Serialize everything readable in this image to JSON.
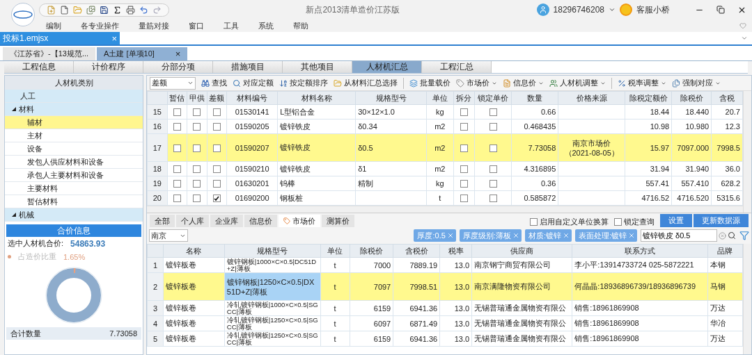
{
  "window": {
    "title": "新点2013清单造价江苏版",
    "user": "18296746208",
    "support": "客服小桥"
  },
  "menu": [
    "编制",
    "各专业操作",
    "量筋对接",
    "窗口",
    "工具",
    "系统",
    "帮助"
  ],
  "doc_tabs": [
    {
      "label": "投标1.emjsx",
      "selected": true,
      "close": "×"
    }
  ],
  "sub_tabs": [
    {
      "label": "《江苏省》-【13规范...",
      "selected": false
    },
    {
      "label": "A土建 [单项10]",
      "selected": true,
      "close": "×"
    }
  ],
  "main_tabs": [
    {
      "label": "工程信息",
      "selected": false
    },
    {
      "label": "计价程序",
      "selected": false
    },
    {
      "label": "分部分项",
      "selected": false
    },
    {
      "label": "措施项目",
      "selected": false
    },
    {
      "label": "其他项目",
      "selected": false
    },
    {
      "label": "人材机汇总",
      "selected": true
    },
    {
      "label": "工程汇总",
      "selected": false
    }
  ],
  "category": {
    "title": "人材机类别",
    "items": [
      {
        "label": "人工",
        "selected": false
      },
      {
        "label": "材料",
        "selected": false,
        "expanded": true,
        "children": [
          {
            "label": "辅材",
            "selected": true
          },
          {
            "label": "主材",
            "selected": false
          },
          {
            "label": "设备",
            "selected": false
          },
          {
            "label": "发包人供应材料和设备",
            "selected": false
          },
          {
            "label": "承包人主要材料和设备",
            "selected": false
          },
          {
            "label": "主要材料",
            "selected": false
          },
          {
            "label": "暂估材料",
            "selected": false
          }
        ]
      },
      {
        "label": "机械",
        "selected": false,
        "expanded": true
      }
    ]
  },
  "summary": {
    "title": "合价信息",
    "total_label": "选中人材机合价:",
    "total": "54863.93",
    "share_label": "占造价比重",
    "share": "1.65%",
    "qty_label": "合计数量",
    "qty": "7.73058"
  },
  "materials": {
    "filter": "差额",
    "toolbar": [
      {
        "kind": "find",
        "label": "查找"
      },
      {
        "kind": "match",
        "label": "对应定额"
      },
      {
        "kind": "sort",
        "label": "按定额排序"
      },
      {
        "kind": "pick",
        "label": "从材料汇总选择"
      },
      {
        "kind": "batch",
        "label": "批量载价",
        "sep": true
      },
      {
        "kind": "market",
        "label": "市场价",
        "dropdown": true
      },
      {
        "kind": "info",
        "label": "信息价",
        "dropdown": true
      },
      {
        "kind": "adjust",
        "label": "人材机调整",
        "dropdown": true
      },
      {
        "kind": "tax",
        "label": "税率调整",
        "dropdown": true,
        "sep": true
      },
      {
        "kind": "force",
        "label": "强制对应",
        "dropdown": true
      }
    ],
    "columns": [
      "暂估",
      "甲供",
      "差额",
      "材料编号",
      "材料名称",
      "规格型号",
      "单位",
      "拆分",
      "锁定单价",
      "数量",
      "价格来源",
      "除税定额价",
      "除税价",
      "含税"
    ],
    "rows": [
      {
        "no": "15",
        "provisional": false,
        "owner_supplied": false,
        "differential": false,
        "code": "01530141",
        "name": "L型铝合金",
        "spec": "30×12×1.0",
        "unit": "kg",
        "split": false,
        "locked": false,
        "qty": "0.66",
        "base_price": "18.44",
        "price": "18.440",
        "tax_price": "20.7",
        "selected": false
      },
      {
        "no": "16",
        "provisional": false,
        "owner_supplied": false,
        "differential": false,
        "code": "01590205",
        "name": "镀锌铁皮",
        "spec": "δ0.34",
        "unit": "m2",
        "split": false,
        "locked": false,
        "qty": "0.468435",
        "base_price": "10.98",
        "price": "10.980",
        "tax_price": "12.3",
        "selected": false
      },
      {
        "no": "17",
        "provisional": false,
        "owner_supplied": false,
        "differential": false,
        "code": "01590207",
        "name": "镀锌铁皮",
        "spec": "δ0.5",
        "unit": "m2",
        "split": false,
        "locked": false,
        "qty": "7.73058",
        "source": "南京市场价（2021-08-05）",
        "base_price": "15.97",
        "price": "7097.000",
        "tax_price": "7998.5",
        "selected": true
      },
      {
        "no": "18",
        "provisional": false,
        "owner_supplied": false,
        "differential": false,
        "code": "01590210",
        "name": "镀锌铁皮",
        "spec": "δ1",
        "unit": "m2",
        "split": false,
        "locked": false,
        "qty": "4.316895",
        "base_price": "31.94",
        "price": "31.940",
        "tax_price": "36.0",
        "selected": false
      },
      {
        "no": "19",
        "provisional": false,
        "owner_supplied": false,
        "differential": false,
        "code": "01630201",
        "name": "钨棒",
        "spec": "精制",
        "unit": "kg",
        "split": false,
        "locked": false,
        "qty": "0.36",
        "base_price": "557.41",
        "price": "557.410",
        "tax_price": "628.2",
        "selected": false
      },
      {
        "no": "20",
        "provisional": false,
        "owner_supplied": false,
        "differential": true,
        "code": "01690200",
        "name": "钢板桩",
        "unit": "t",
        "split": false,
        "locked": false,
        "qty": "0.585872",
        "base_price": "4716.52",
        "price": "4716.520",
        "tax_price": "5315.6",
        "selected": false
      }
    ]
  },
  "market": {
    "tabs": [
      {
        "label": "全部",
        "selected": false
      },
      {
        "label": "个人库",
        "selected": false
      },
      {
        "label": "企业库",
        "selected": false
      },
      {
        "label": "信息价",
        "selected": false
      },
      {
        "label": "市场价",
        "selected": true,
        "icon": true
      },
      {
        "label": "测算价",
        "selected": false
      }
    ],
    "options": [
      {
        "label": "启用自定义单位换算",
        "checked": false
      },
      {
        "label": "锁定查询",
        "checked": false
      }
    ],
    "buttons": [
      "设置",
      "更新数据源"
    ],
    "city": "南京",
    "filters": [
      "厚度:0.5",
      "厚度级别:薄板",
      "材质:镀锌",
      "表面处理:镀锌"
    ],
    "search": {
      "value": "镀锌铁皮 δ0.5"
    },
    "columns": [
      "名称",
      "规格型号",
      "单位",
      "除税价",
      "含税价",
      "税率",
      "供应商",
      "联系方式",
      "品牌"
    ],
    "rows": [
      {
        "no": "1",
        "name": "镀锌板卷",
        "spec": "镀锌钢板|1000×C×0.5|DC51D+Z|薄板",
        "unit": "t",
        "price": "7000",
        "tax_price": "7889.19",
        "rate": "13.0",
        "supplier": "南京钢宁商贸有限公司",
        "contact": "李小平:13914733724 025-5872221",
        "brand": "本钢",
        "selected": false
      },
      {
        "no": "2",
        "name": "镀锌板卷",
        "spec": "镀锌钢板|1250×C×0.5|DX51D+Z|薄板",
        "unit": "t",
        "price": "7097",
        "tax_price": "7998.51",
        "rate": "13.0",
        "supplier": "南京满隆物资有限公司",
        "contact": "何晶晶:18936896739/18936896739",
        "brand": "马钢",
        "selected": true
      },
      {
        "no": "3",
        "name": "镀锌板卷",
        "spec": "冷轧镀锌钢板|1000×C×0.5|SGCC|薄板",
        "unit": "t",
        "price": "6159",
        "tax_price": "6941.36",
        "rate": "13.0",
        "supplier": "无锡普瑞通金属物资有限公",
        "contact": "销售:18961869908",
        "brand": "万达",
        "selected": false
      },
      {
        "no": "4",
        "name": "镀锌板卷",
        "spec": "冷轧镀锌钢板|1250×C×0.5|SGCC|薄板",
        "unit": "t",
        "price": "6097",
        "tax_price": "6871.49",
        "rate": "13.0",
        "supplier": "无锡普瑞通金属物资有限公",
        "contact": "销售:18961869908",
        "brand": "华冶",
        "selected": false
      },
      {
        "no": "5",
        "name": "镀锌板卷",
        "spec": "冷轧镀锌钢板|1250×C×0.5|SGCC|薄板",
        "unit": "t",
        "price": "6159",
        "tax_price": "6941.36",
        "rate": "13.0",
        "supplier": "无锡普瑞通金属物资有限公",
        "contact": "销售:18961869908",
        "brand": "万达",
        "selected": false
      }
    ]
  }
}
